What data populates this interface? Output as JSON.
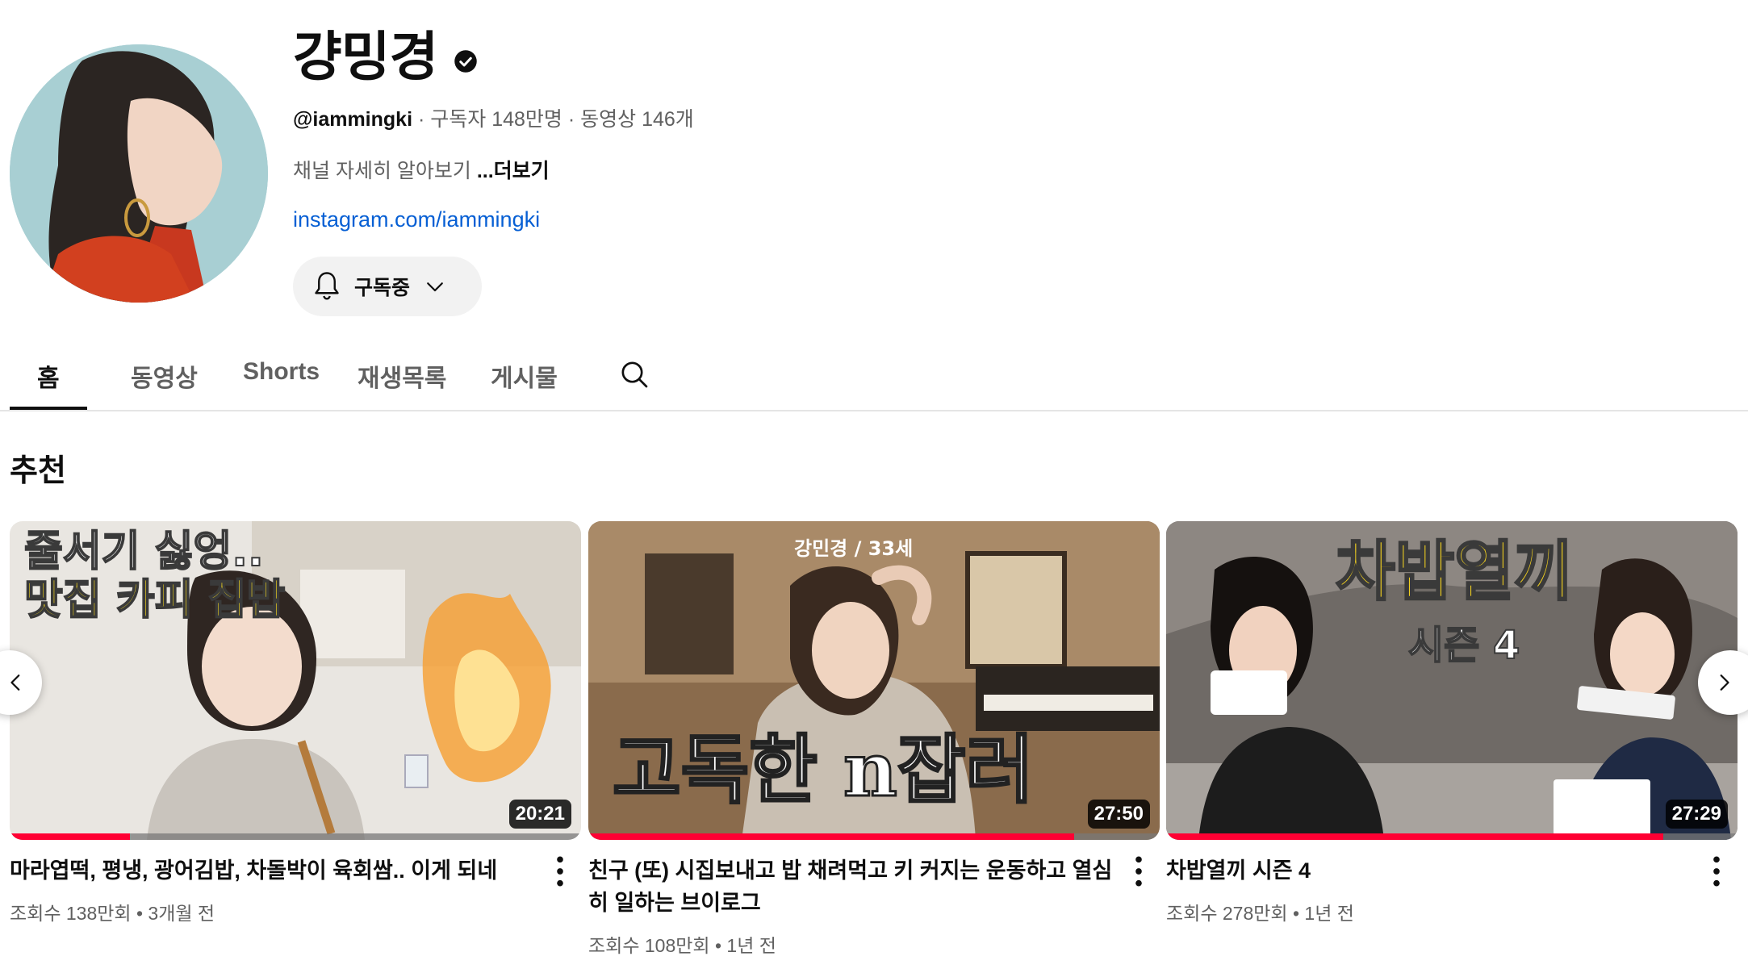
{
  "channel": {
    "name": "걍밍경",
    "handle": "@iammingki",
    "sep1": " · ",
    "subscribers": "구독자 148만명",
    "sep2": " · ",
    "videos": "동영상 146개",
    "description": "채널 자세히 알아보기 ",
    "more": "...더보기",
    "link": "instagram.com/iammingki",
    "subscribe_label": "구독중"
  },
  "tabs": [
    {
      "label": "홈",
      "active": true
    },
    {
      "label": "동영상",
      "active": false
    },
    {
      "label": "Shorts",
      "active": false
    },
    {
      "label": "재생목록",
      "active": false
    },
    {
      "label": "게시물",
      "active": false
    }
  ],
  "section": {
    "title": "추천"
  },
  "videos": [
    {
      "title": "마라엽떡, 평냉, 광어김밥, 차돌박이 육회쌈.. 이게 되네",
      "views": "조회수 138만회",
      "dot": " • ",
      "age": "3개월 전",
      "duration": "20:21",
      "progress": 0.21,
      "thumb_text_1": "줄서기 싫엉..",
      "thumb_text_2": "맛집 카피 집밥"
    },
    {
      "title": "친구 (또) 시집보내고 밥 채려먹고 키 커지는 운동하고 열심히 일하는 브이로그",
      "views": "조회수 108만회",
      "dot": " • ",
      "age": "1년 전",
      "duration": "27:50",
      "progress": 0.85,
      "thumb_text_1": "강민경 / 33세",
      "thumb_text_2": "고독한 n잡러"
    },
    {
      "title": "차밥열끼 시즌 4",
      "views": "조회수 278만회",
      "dot": " • ",
      "age": "1년 전",
      "duration": "27:29",
      "progress": 0.87,
      "thumb_text_1": "차밥열끼",
      "thumb_text_2": "시즌 4"
    }
  ],
  "colors": {
    "accent": "#ff0033",
    "link": "#065fd4",
    "text_secondary": "#606060"
  }
}
